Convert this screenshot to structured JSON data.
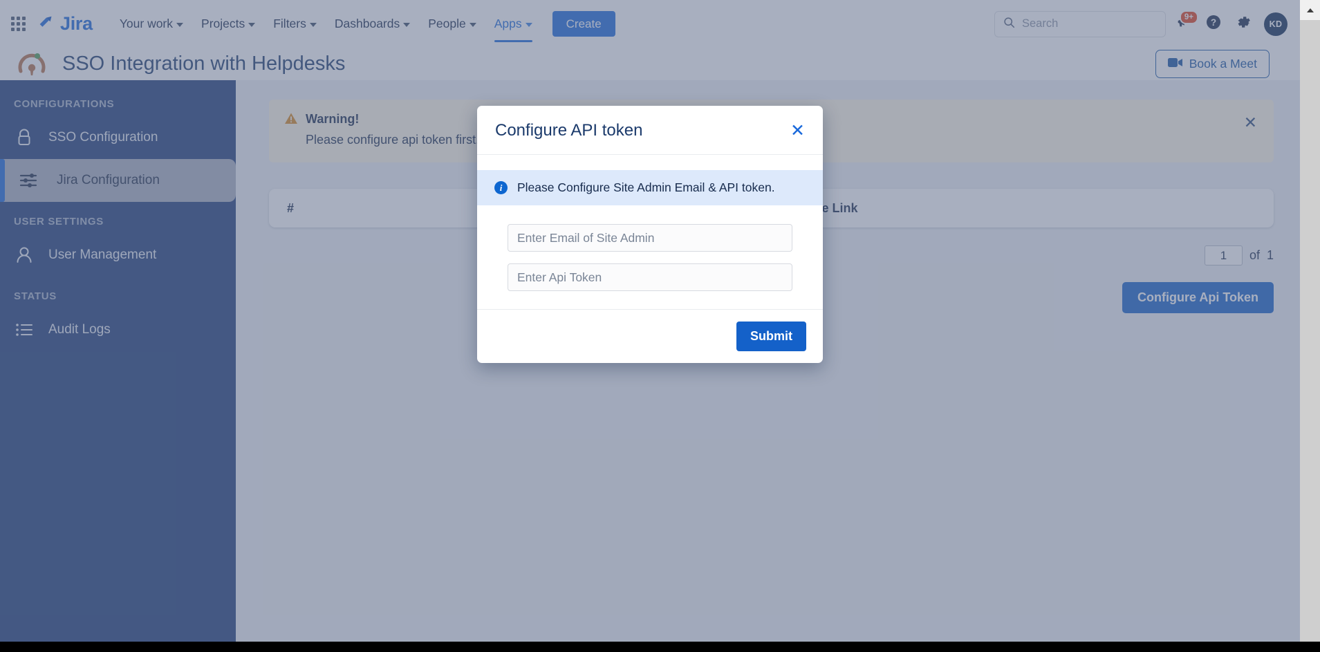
{
  "jira_nav": {
    "apps_icon": "app-switcher-grid-icon",
    "brand": "Jira",
    "links": [
      {
        "label": "Your work",
        "has_caret": true,
        "active": false
      },
      {
        "label": "Projects",
        "has_caret": true,
        "active": false
      },
      {
        "label": "Filters",
        "has_caret": true,
        "active": false
      },
      {
        "label": "Dashboards",
        "has_caret": true,
        "active": false
      },
      {
        "label": "People",
        "has_caret": true,
        "active": false
      },
      {
        "label": "Apps",
        "has_caret": true,
        "active": true
      }
    ],
    "create_label": "Create",
    "search_placeholder": "Search",
    "notifications_badge": "9+",
    "help_icon": "question-mark-icon",
    "settings_icon": "gear-icon",
    "avatar_initials": "KD"
  },
  "app_header": {
    "logo_icon": "padlock-keyhole-logo",
    "title": "SSO Integration with Helpdesks",
    "book_meet_label": "Book a Meet",
    "book_meet_icon": "video-camera-icon"
  },
  "sidebar": {
    "sections": [
      {
        "label": "CONFIGURATIONS",
        "items": [
          {
            "label": "SSO Configuration",
            "icon": "padlock-icon",
            "active": false
          },
          {
            "label": "Jira Configuration",
            "icon": "sliders-icon",
            "active": true
          }
        ]
      },
      {
        "label": "USER SETTINGS",
        "items": [
          {
            "label": "User Management",
            "icon": "person-icon",
            "active": false
          }
        ]
      },
      {
        "label": "STATUS",
        "items": [
          {
            "label": "Audit Logs",
            "icon": "list-icon",
            "active": false
          }
        ]
      }
    ]
  },
  "main": {
    "warning": {
      "icon": "warning-triangle-icon",
      "title": "Warning!",
      "message": "Please configure api token first.",
      "close_icon": "close-icon"
    },
    "table": {
      "columns": [
        "#",
        "Substitute Link"
      ],
      "rows": []
    },
    "pagination": {
      "current_page": "1",
      "of_label": "of",
      "total_pages": "1"
    },
    "configure_button_label": "Configure Api Token"
  },
  "modal": {
    "title": "Configure API token",
    "close_icon": "close-icon",
    "info": {
      "icon": "info-circle-icon",
      "text": "Please Configure Site Admin Email & API token."
    },
    "fields": [
      {
        "name": "site-admin-email",
        "value": "",
        "placeholder": "Enter Email of Site Admin"
      },
      {
        "name": "api-token",
        "value": "",
        "placeholder": "Enter Api Token"
      }
    ],
    "submit_label": "Submit"
  },
  "colors": {
    "jira_blue": "#1868db",
    "sidebar_navy": "#1c3a77",
    "button_blue": "#1461c9",
    "warning_amber": "#d98a1e",
    "info_bg": "#dde9fb",
    "overlay": "rgba(100,113,140,.56)"
  }
}
